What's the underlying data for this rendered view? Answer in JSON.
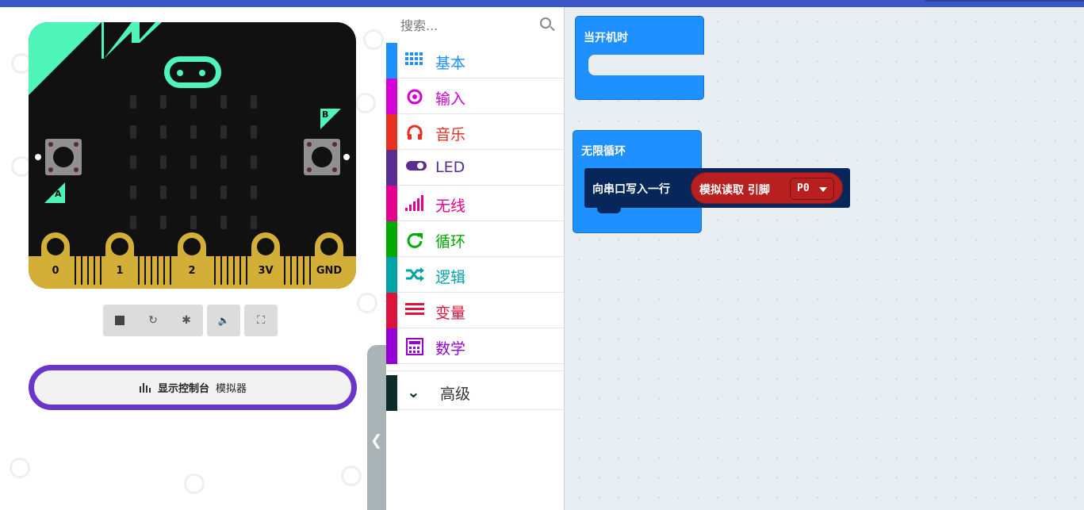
{
  "simulator": {
    "pins": [
      "0",
      "1",
      "2",
      "3V",
      "GND"
    ],
    "button_a_label": "A",
    "button_b_label": "B",
    "console_button_label": "显示控制台",
    "console_button_sub": "模拟器"
  },
  "toolbox": {
    "search_placeholder": "搜索...",
    "categories": [
      {
        "label": "基本",
        "color": "#1e90ff",
        "icon": "grid-icon"
      },
      {
        "label": "输入",
        "color": "#d400d4",
        "icon": "target-icon"
      },
      {
        "label": "音乐",
        "color": "#e63022",
        "icon": "headphones-icon"
      },
      {
        "label": "LED",
        "color": "#5c2d91",
        "icon": "toggle-icon"
      },
      {
        "label": "无线",
        "color": "#e3008c",
        "icon": "signal-icon"
      },
      {
        "label": "循环",
        "color": "#00aa00",
        "icon": "refresh-icon"
      },
      {
        "label": "逻辑",
        "color": "#00a4a6",
        "icon": "shuffle-icon"
      },
      {
        "label": "变量",
        "color": "#dc143c",
        "icon": "lines-icon"
      },
      {
        "label": "数学",
        "color": "#9400d3",
        "icon": "calculator-icon"
      }
    ],
    "advanced_label": "高级"
  },
  "workspace": {
    "on_start_label": "当开机时",
    "forever_label": "无限循环",
    "serial_write_label": "向串口写入一行",
    "analog_read_label": "模拟读取 引脚",
    "pin_dropdown_value": "P0"
  }
}
